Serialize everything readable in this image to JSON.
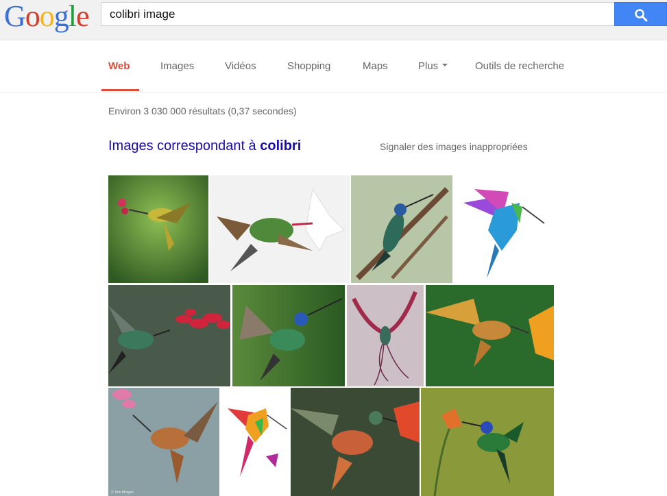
{
  "logo": {
    "letters": [
      "G",
      "o",
      "o",
      "g",
      "l",
      "e"
    ]
  },
  "search": {
    "query": "colibri image"
  },
  "nav": {
    "tabs": [
      {
        "label": "Web",
        "active": true
      },
      {
        "label": "Images",
        "active": false
      },
      {
        "label": "Vidéos",
        "active": false
      },
      {
        "label": "Shopping",
        "active": false
      },
      {
        "label": "Maps",
        "active": false
      },
      {
        "label": "Plus",
        "active": false,
        "dropdown": true
      },
      {
        "label": "Outils de recherche",
        "active": false
      }
    ]
  },
  "stats": {
    "text": "Environ 3 030 000 résultats (0,37 secondes)"
  },
  "images_section": {
    "heading_prefix": "Images correspondant à ",
    "heading_term": "colibri",
    "report_link": "Signaler des images inappropriées"
  },
  "thumbnails": {
    "caption_tom": "© Tom Morgan"
  },
  "colors": {
    "accent_red": "#dd4b39",
    "link_blue": "#1a0dab",
    "search_blue": "#4285f4"
  }
}
